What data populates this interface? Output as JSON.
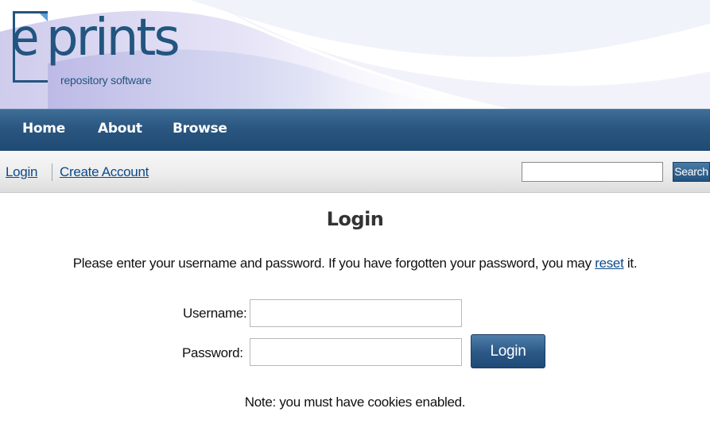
{
  "header": {
    "logo_text_e": "e",
    "logo_text_rest": "prints",
    "tagline": "repository software"
  },
  "nav": {
    "items": [
      {
        "label": "Home"
      },
      {
        "label": "About"
      },
      {
        "label": "Browse"
      }
    ]
  },
  "toolbar": {
    "login_link": "Login",
    "create_account_link": "Create Account",
    "search_input_value": "",
    "search_button": "Search"
  },
  "main": {
    "title": "Login",
    "intro_before": "Please enter your username and password. If you have forgotten your password, you may ",
    "intro_link": "reset",
    "intro_after": " it.",
    "username_label": "Username:",
    "password_label": "Password:",
    "username_value": "",
    "password_value": "",
    "login_button": "Login",
    "note": "Note: you must have cookies enabled."
  },
  "colors": {
    "brand": "#22557f",
    "nav_bg": "#2a5680",
    "link": "#0e4a8a"
  }
}
